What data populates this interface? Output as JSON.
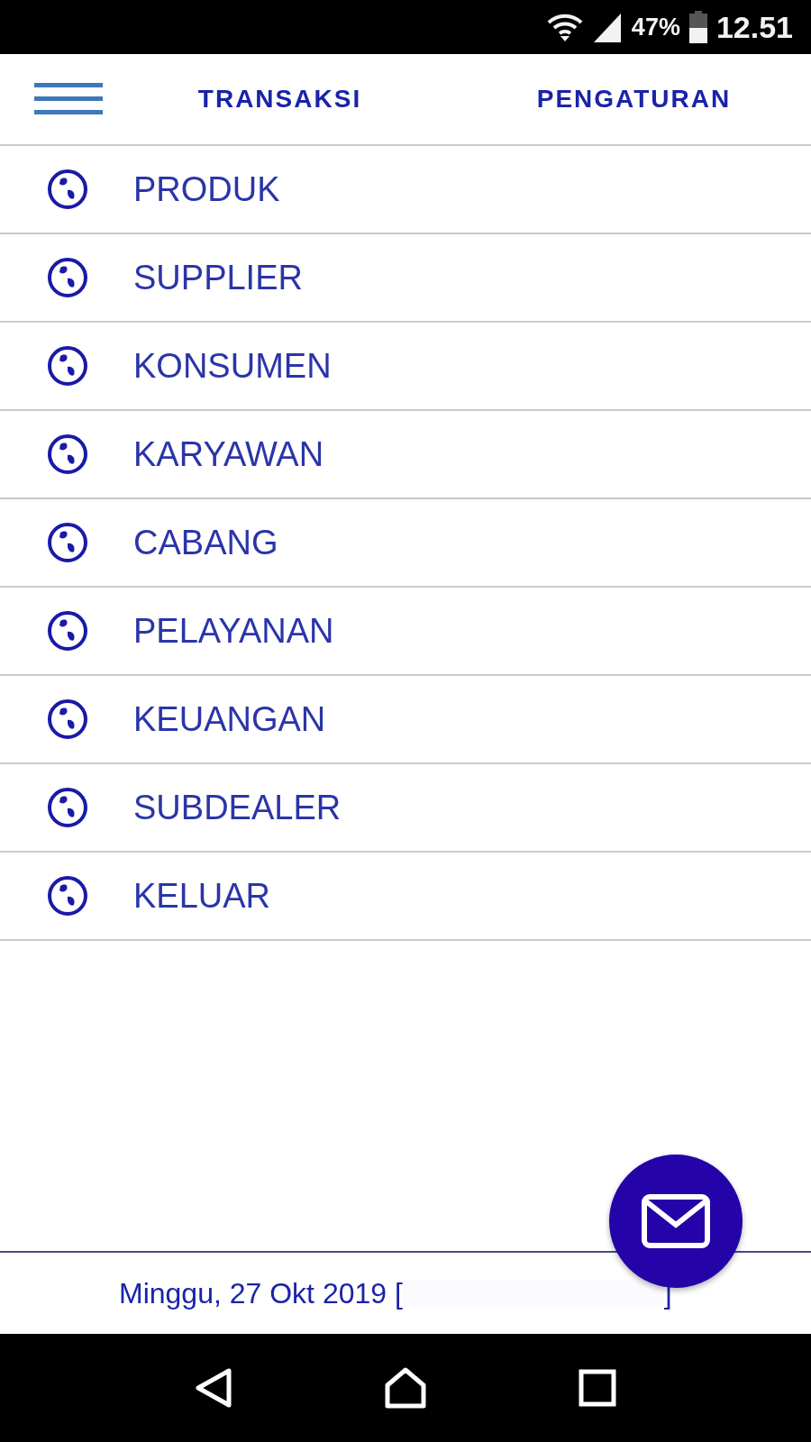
{
  "status_bar": {
    "battery": "47%",
    "time": "12.51"
  },
  "header": {
    "tabs": [
      {
        "label": "TRANSAKSI"
      },
      {
        "label": "PENGATURAN"
      }
    ]
  },
  "menu": [
    {
      "label": "PRODUK"
    },
    {
      "label": "SUPPLIER"
    },
    {
      "label": "KONSUMEN"
    },
    {
      "label": "KARYAWAN"
    },
    {
      "label": "CABANG"
    },
    {
      "label": "PELAYANAN"
    },
    {
      "label": "KEUANGAN"
    },
    {
      "label": "SUBDEALER"
    },
    {
      "label": "KELUAR"
    }
  ],
  "footer": {
    "date": "Minggu, 27 Okt 2019 [",
    "close": "]"
  }
}
